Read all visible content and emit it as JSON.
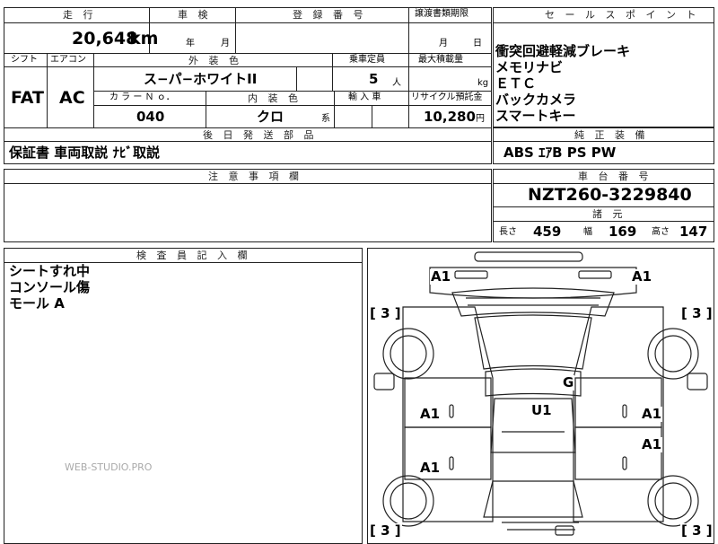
{
  "top": {
    "mileage_header": "走 行",
    "inspection_header": "車 検",
    "registration_header": "登 録 番 号",
    "transfer_header": "譲渡書類期限",
    "sales_point_header": "セ ー ル ス ポ イ ン ト",
    "mileage_value": "20,648",
    "mileage_unit": "km",
    "inspection_year": "年",
    "inspection_month": "月",
    "transfer_month": "月",
    "transfer_day": "日"
  },
  "specs": {
    "shift_header": "シフト",
    "ac_header": "エアコン",
    "exterior_header": "外 装 色",
    "capacity_header": "乗車定員",
    "max_load_header": "最大積載量",
    "shift_value": "FAT",
    "ac_value": "AC",
    "exterior_value": "ス−パ−ホワイトII",
    "capacity_value": "5",
    "capacity_unit": "人",
    "max_load_unit": "kg",
    "color_no_header": "カ ラ ー Ｎ ｏ．",
    "interior_header": "内 装 色",
    "import_header": "輸 入 車",
    "recycle_header": "リサイクル預託金",
    "color_no_value": "040",
    "interior_value": "クロ",
    "interior_suffix": "系",
    "recycle_value": "10,280",
    "recycle_unit": "円"
  },
  "sales_points": [
    "衝突回避軽減ブレーキ",
    "メモリナビ",
    "ＥＴＣ",
    "バックカメラ",
    "スマートキー"
  ],
  "later_parts": {
    "header": "後 日 発 送 部 品",
    "value": "保証書 車両取説 ﾅﾋﾞ取説"
  },
  "equipment": {
    "header": "純 正 装 備",
    "value": "ABS ｴｱB PS PW"
  },
  "notes": {
    "header": "注 意 事 項 欄"
  },
  "chassis": {
    "header": "車 台 番 号",
    "value": "NZT260-3229840"
  },
  "dimensions": {
    "header": "諸 元",
    "length_label": "長さ",
    "length_value": "459",
    "width_label": "幅",
    "width_value": "169",
    "height_label": "高さ",
    "height_value": "147"
  },
  "inspector": {
    "header": "検 査 員 記 入 欄",
    "lines": [
      "シートすれ中",
      "コンソール傷",
      "モール A"
    ]
  },
  "diagram_marks": {
    "front_left": "A1",
    "front_right": "A1",
    "bracket_tl": "[ 3 ]",
    "bracket_tr": "[ 3 ]",
    "bracket_bl": "[ 3 ]",
    "bracket_br": "[ 3 ]",
    "roof": "G",
    "center": "U1",
    "left_front_door": "A1",
    "right_front_door": "A1",
    "right_rear_door": "A1",
    "left_rear_door": "A1"
  },
  "watermark": "WEB-STUDIO.PRO"
}
